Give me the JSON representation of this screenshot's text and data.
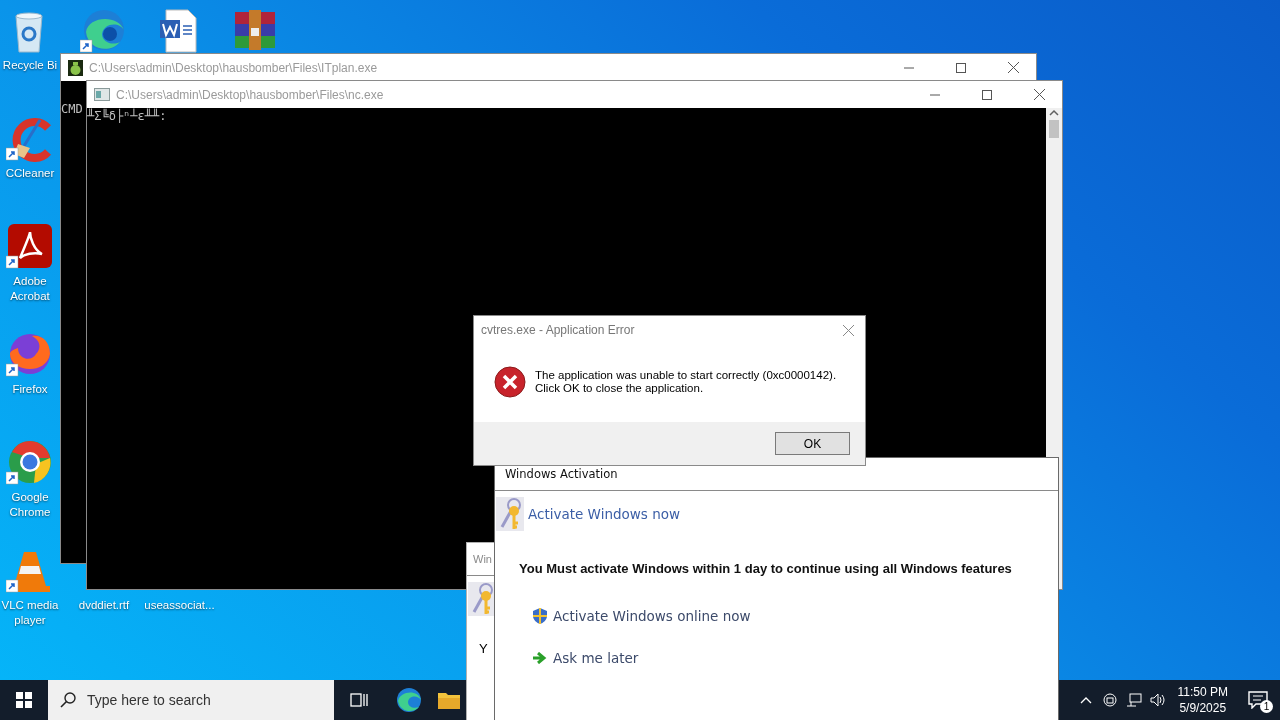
{
  "desktop": {
    "left_column": [
      {
        "label": "Recycle Bi",
        "kind": "recycle",
        "shortcut": false
      },
      {
        "label": "CCleaner",
        "kind": "ccleaner",
        "shortcut": true
      },
      {
        "label": "Adobe Acrobat",
        "kind": "acrobat",
        "shortcut": true
      },
      {
        "label": "Firefox",
        "kind": "firefox",
        "shortcut": true
      },
      {
        "label": "Google Chrome",
        "kind": "chrome",
        "shortcut": true
      },
      {
        "label": "VLC media player",
        "kind": "vlc",
        "shortcut": true
      }
    ],
    "top_row": [
      {
        "kind": "edge",
        "shortcut": true
      },
      {
        "kind": "word",
        "shortcut": false
      },
      {
        "kind": "winrar",
        "shortcut": false
      }
    ],
    "bottom_row": [
      {
        "label": "dvddiet.rtf"
      },
      {
        "label": "useassociat..."
      }
    ]
  },
  "windows": [
    {
      "title": "C:\\Users\\admin\\Desktop\\hausbomber\\Files\\ITplan.exe",
      "kind": "itplan",
      "console_text": "CMD"
    },
    {
      "title": "C:\\Users\\admin\\Desktop\\hausbomber\\Files\\nc.exe",
      "kind": "console",
      "console_text": "╨Σ╚δ├ⁿ┴ε╨╨:"
    }
  ],
  "error_dialog": {
    "title": "cvtres.exe - Application Error",
    "message": [
      "The application was unable to start correctly (0xc0000142).",
      "Click OK to close the application."
    ],
    "button": "OK"
  },
  "activation_behind": {
    "title": "Win",
    "text": "Y"
  },
  "activation": {
    "title": "Windows Activation",
    "heading": "Activate Windows now",
    "message": "You Must activate Windows within 1 day to continue using all Windows features",
    "options": [
      {
        "label": "Activate Windows online now",
        "kind": "shield"
      },
      {
        "label": "Ask me later",
        "kind": "arrow"
      }
    ]
  },
  "taskbar": {
    "search": {
      "placeholder": "Type here to search"
    },
    "clock": {
      "time": "11:50 PM",
      "date": "5/9/2025"
    },
    "notification_count": "1"
  }
}
